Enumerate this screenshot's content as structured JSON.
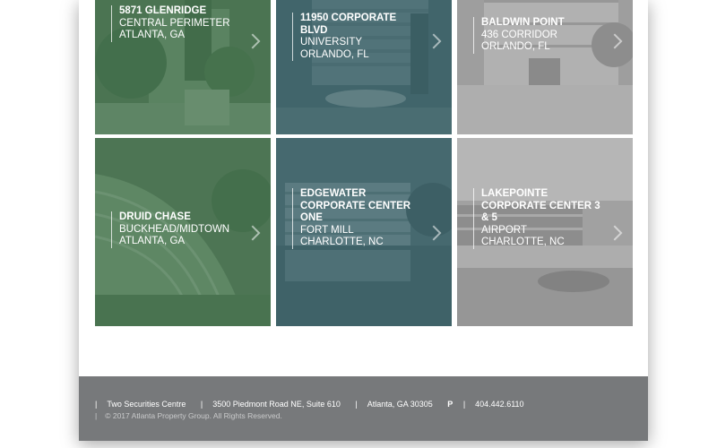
{
  "properties": [
    {
      "name_lines": [
        "5871 GLENRIDGE"
      ],
      "detail_lines": [
        "CENTRAL PERIMETER",
        "ATLANTA, GA"
      ],
      "tint": "#3d6b45"
    },
    {
      "name_lines": [
        "11950 CORPORATE",
        "BLVD"
      ],
      "detail_lines": [
        "UNIVERSITY",
        "ORLANDO, FL"
      ],
      "tint": "#2f5459"
    },
    {
      "name_lines": [
        "BALDWIN POINT"
      ],
      "detail_lines": [
        "436 CORRIDOR",
        "ORLANDO, FL"
      ],
      "tint": "#8b8b8b"
    },
    {
      "name_lines": [
        "DRUID CHASE"
      ],
      "detail_lines": [
        "BUCKHEAD/MIDTOWN",
        "ATLANTA, GA"
      ],
      "tint": "#3d6b45"
    },
    {
      "name_lines": [
        "EDGEWATER",
        "CORPORATE CENTER",
        "ONE"
      ],
      "detail_lines": [
        "FORT MILL",
        "CHARLOTTE, NC"
      ],
      "tint": "#2f5459"
    },
    {
      "name_lines": [
        "LAKEPOINTE",
        "CORPORATE CENTER 3",
        "& 5"
      ],
      "detail_lines": [
        "AIRPORT",
        "CHARLOTTE, NC"
      ],
      "tint": "#8b8b8b"
    }
  ],
  "footer": {
    "address_name": "Two Securities Centre",
    "street": "3500 Piedmont Road NE, Suite 610",
    "city": "Atlanta, GA 30305",
    "phone_label": "P",
    "phone": "404.442.6110",
    "copyright": "© 2017 Atlanta Property Group. All Rights Reserved."
  }
}
